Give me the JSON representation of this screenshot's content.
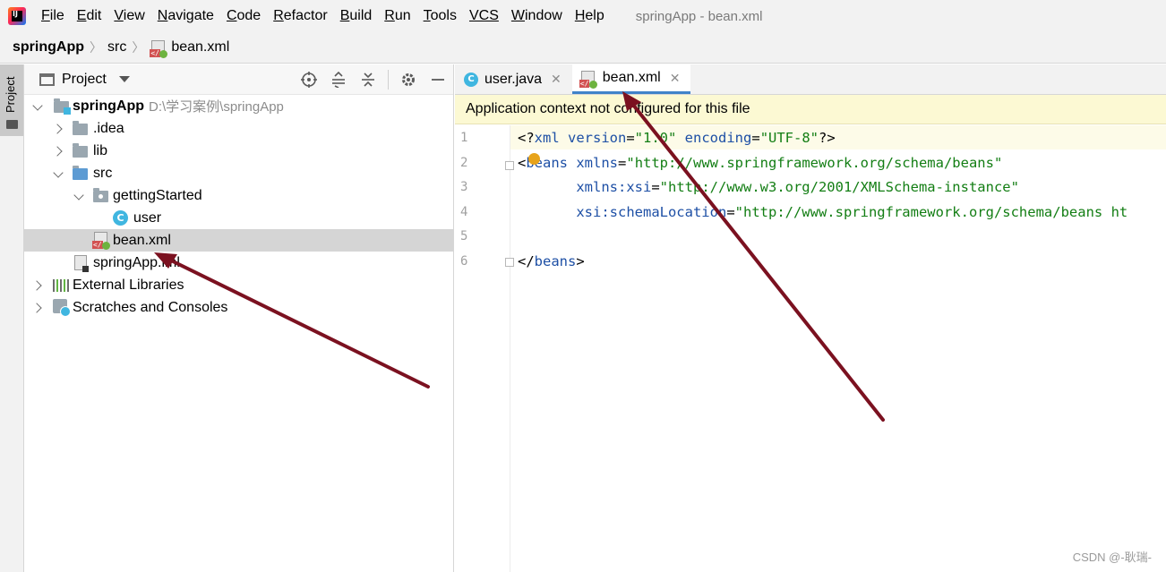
{
  "menu": {
    "items": [
      {
        "mnemonic": "F",
        "rest": "ile"
      },
      {
        "mnemonic": "E",
        "rest": "dit"
      },
      {
        "mnemonic": "V",
        "rest": "iew"
      },
      {
        "mnemonic": "N",
        "rest": "avigate"
      },
      {
        "mnemonic": "C",
        "rest": "ode"
      },
      {
        "mnemonic": "R",
        "rest": "efactor"
      },
      {
        "mnemonic": "B",
        "rest": "uild"
      },
      {
        "mnemonic": "R",
        "rest": "un"
      },
      {
        "mnemonic": "T",
        "rest": "ools"
      },
      {
        "mnemonic": "VCS",
        "rest": ""
      },
      {
        "mnemonic": "W",
        "rest": "indow"
      },
      {
        "mnemonic": "H",
        "rest": "elp"
      }
    ],
    "window_title": "springApp - bean.xml"
  },
  "breadcrumb": [
    "springApp",
    "src",
    "bean.xml"
  ],
  "stripe": {
    "project_label": "Project"
  },
  "project_panel": {
    "title": "Project",
    "tree": [
      {
        "label": "springApp",
        "hint": "D:\\学习案例\\springApp",
        "bold": true
      },
      {
        "label": ".idea"
      },
      {
        "label": "lib"
      },
      {
        "label": "src"
      },
      {
        "label": "gettingStarted"
      },
      {
        "label": "user"
      },
      {
        "label": "bean.xml",
        "selected": true
      },
      {
        "label": "springApp.iml"
      },
      {
        "label": "External Libraries"
      },
      {
        "label": "Scratches and Consoles"
      }
    ]
  },
  "editor": {
    "tabs": [
      {
        "label": "user.java",
        "active": false
      },
      {
        "label": "bean.xml",
        "active": true
      }
    ],
    "notice": "Application context not configured for this file",
    "line_numbers": [
      "1",
      "2",
      "3",
      "4",
      "5",
      "6"
    ],
    "code": {
      "l1": {
        "open": "<?",
        "tag": "xml",
        "a1": " version",
        "eq1": "=",
        "v1": "\"1.0\"",
        "a2": " encoding",
        "eq2": "=",
        "v2": "\"UTF-8\"",
        "close": "?>"
      },
      "l2": {
        "open": "<",
        "tag": "beans",
        "a1": " xmlns",
        "eq1": "=",
        "v1": "\"http://www.springframework.org/schema/beans\""
      },
      "l3": {
        "indent": "       ",
        "a1": "xmlns:xsi",
        "eq1": "=",
        "v1": "\"http://www.w3.org/2001/XMLSchema-instance\""
      },
      "l4": {
        "indent": "       ",
        "a1": "xsi:schemaLocation",
        "eq1": "=",
        "v1": "\"http://www.springframework.org/schema/beans ht"
      },
      "l6": {
        "open": "</",
        "tag": "beans",
        "close": ">"
      }
    }
  },
  "watermark": "CSDN @-耿瑞-",
  "colors": {
    "annotation_arrow": "#7b1120",
    "tab_underline": "#4083c9",
    "notice_bg": "#fcf9d3",
    "selection": "#d5d5d5"
  }
}
